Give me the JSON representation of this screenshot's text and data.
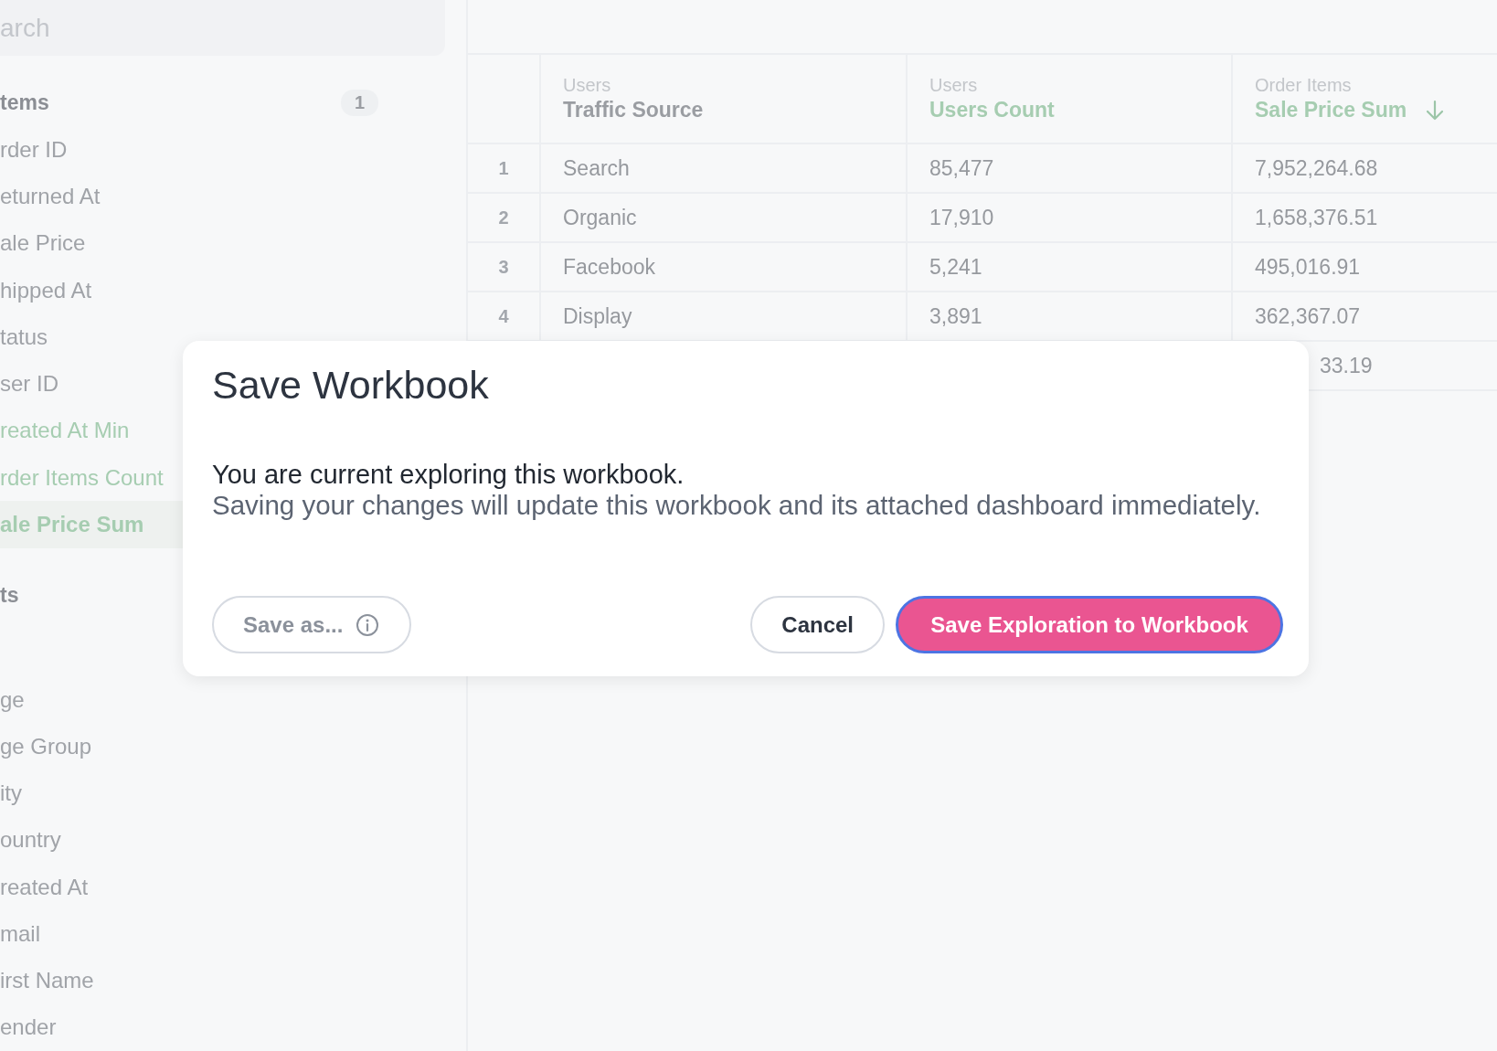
{
  "search": {
    "placeholder": "arch"
  },
  "sidebar": {
    "groups": [
      {
        "label": "tems",
        "count": "1",
        "items": [
          {
            "label": "rder ID",
            "kind": "dimension",
            "selected": false
          },
          {
            "label": "eturned At",
            "kind": "dimension",
            "selected": false
          },
          {
            "label": "ale Price",
            "kind": "dimension",
            "selected": false
          },
          {
            "label": "hipped At",
            "kind": "dimension",
            "selected": false
          },
          {
            "label": "tatus",
            "kind": "dimension",
            "selected": false
          },
          {
            "label": "ser ID",
            "kind": "dimension",
            "selected": false
          },
          {
            "label": "reated At Min",
            "kind": "measure",
            "selected": false
          },
          {
            "label": "rder Items Count",
            "kind": "measure",
            "selected": false
          },
          {
            "label": "ale Price Sum",
            "kind": "measure",
            "selected": true
          }
        ]
      },
      {
        "label": "ts",
        "items": [
          {
            "label": "ge",
            "kind": "dimension",
            "selected": false
          },
          {
            "label": "ge Group",
            "kind": "dimension",
            "selected": false
          },
          {
            "label": "ity",
            "kind": "dimension",
            "selected": false
          },
          {
            "label": "ountry",
            "kind": "dimension",
            "selected": false
          },
          {
            "label": "reated At",
            "kind": "dimension",
            "selected": false
          },
          {
            "label": "mail",
            "kind": "dimension",
            "selected": false
          },
          {
            "label": "irst Name",
            "kind": "dimension",
            "selected": false
          },
          {
            "label": "ender",
            "kind": "dimension",
            "selected": false
          }
        ]
      }
    ]
  },
  "table": {
    "columns": [
      {
        "group": "Users",
        "label": "Traffic Source",
        "kind": "dimension",
        "sorted": false
      },
      {
        "group": "Users",
        "label": "Users Count",
        "kind": "measure",
        "sorted": false
      },
      {
        "group": "Order Items",
        "label": "Sale Price Sum",
        "kind": "measure",
        "sorted": true
      }
    ],
    "rows": [
      {
        "number": "1",
        "cells": [
          "Search",
          "85,477",
          "7,952,264.68"
        ]
      },
      {
        "number": "2",
        "cells": [
          "Organic",
          "17,910",
          "1,658,376.51"
        ]
      },
      {
        "number": "3",
        "cells": [
          "Facebook",
          "5,241",
          "495,016.91"
        ]
      },
      {
        "number": "4",
        "cells": [
          "Display",
          "3,891",
          "362,367.07"
        ]
      },
      {
        "cells": [
          null,
          null,
          "33.19"
        ],
        "covered": true
      }
    ]
  },
  "dialog": {
    "title": "Save Workbook",
    "message": "You are current exploring this workbook.",
    "detail": "Saving your changes will update this workbook and its attached dashboard immediately.",
    "buttons": [
      {
        "label": "Save as...",
        "kind": "secondary"
      },
      {
        "label": "Cancel",
        "kind": "cancel"
      },
      {
        "label": "Save Exploration to Workbook",
        "kind": "primary"
      }
    ]
  }
}
